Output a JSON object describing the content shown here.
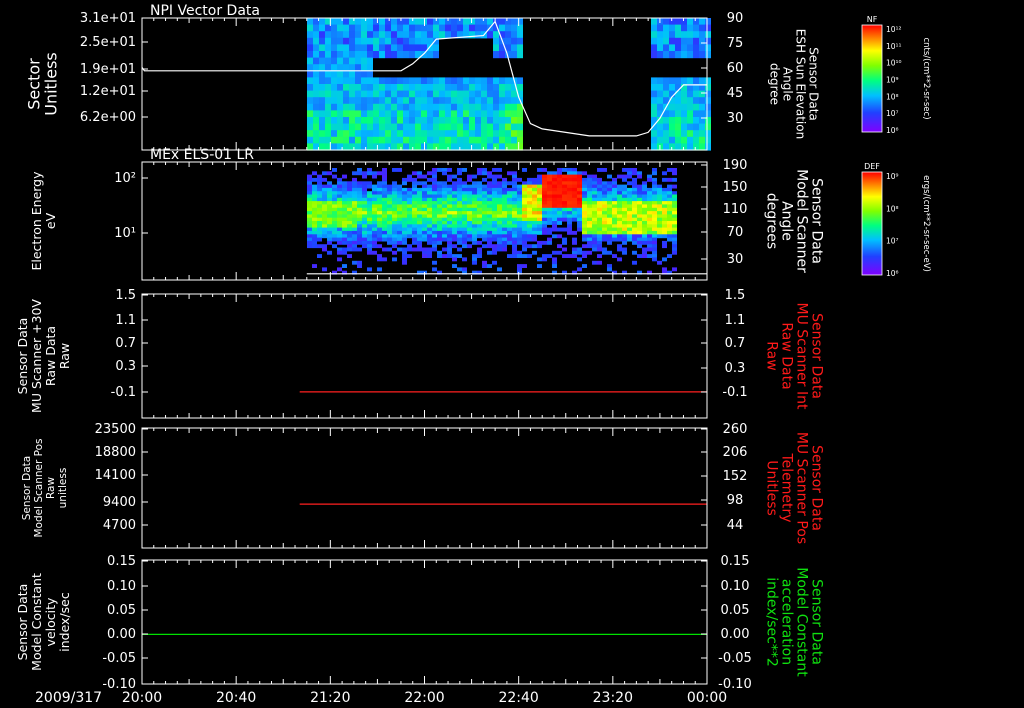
{
  "x_axis": {
    "date_label": "2009/317",
    "ticks": [
      "20:00",
      "20:40",
      "21:20",
      "22:00",
      "22:40",
      "23:20",
      "00:00"
    ],
    "range_minutes": [
      0,
      240
    ]
  },
  "colors": {
    "white_line": "#ffffff",
    "red_line": "#ff2020",
    "green_line": "#00e000",
    "red_axis_text": "#ff1a1a",
    "green_axis_text": "#10e010"
  },
  "panels": [
    {
      "id": "npi",
      "title": "NPI Vector Data",
      "left_label": [
        "Sector",
        "Unitless"
      ],
      "left_ticks": [
        "3.1e+01",
        "2.5e+01",
        "1.9e+01",
        "1.2e+01",
        "6.2e+00"
      ],
      "right_label": [
        "Sensor Data",
        "ESH Sun Elevation",
        "Angle",
        "degree"
      ],
      "right_label_color": "#ffffff",
      "right_ticks": [
        "90",
        "75",
        "60",
        "45",
        "30"
      ],
      "colorbar": {
        "tag": "NF",
        "units": "cnts/(cm**2-sr-sec)",
        "ticks": [
          "10¹²",
          "10¹¹",
          "10¹⁰",
          "10⁹",
          "10⁸",
          "10⁷",
          "10⁶"
        ]
      }
    },
    {
      "id": "els",
      "title": "MEx ELS-01 LR",
      "left_label": [
        "Electron Energy",
        "eV"
      ],
      "left_ticks": [
        "10²",
        "10¹"
      ],
      "right_label": [
        "Sensor Data",
        "Model Scanner",
        "Angle",
        "degrees"
      ],
      "right_label_color": "#ffffff",
      "right_ticks": [
        "190",
        "150",
        "110",
        "70",
        "30"
      ],
      "colorbar": {
        "tag": "DEF",
        "units": "ergs/(cm**2-sr-sec-eV)",
        "ticks": [
          "10⁹",
          "10⁸",
          "10⁷",
          "10⁶"
        ]
      }
    },
    {
      "id": "mu-raw",
      "title": "",
      "left_label": [
        "Sensor Data",
        "MU Scanner +30V",
        "Raw Data",
        "Raw"
      ],
      "left_ticks": [
        "1.5",
        "1.1",
        "0.7",
        "0.3",
        "-0.1"
      ],
      "right_label": [
        "Sensor Data",
        "MU Scanner Int",
        "Raw Data",
        "Raw"
      ],
      "right_label_color": "#ff1a1a",
      "right_ticks": [
        "1.5",
        "1.1",
        "0.7",
        "0.3",
        "-0.1"
      ]
    },
    {
      "id": "mu-pos",
      "title": "",
      "left_label": [
        "Sensor Data",
        "Model Scanner Pos",
        "Raw",
        "unitless"
      ],
      "left_ticks": [
        "23500",
        "18800",
        "14100",
        "9400",
        "4700"
      ],
      "right_label": [
        "Sensor Data",
        "MU Scanner Pos",
        "Telemetry",
        "Unitless"
      ],
      "right_label_color": "#ff1a1a",
      "right_ticks": [
        "260",
        "206",
        "152",
        "98",
        "44"
      ]
    },
    {
      "id": "velocity",
      "title": "",
      "left_label": [
        "Sensor Data",
        "Model Constant",
        "velocity",
        "index/sec"
      ],
      "left_ticks": [
        "0.15",
        "0.10",
        "0.05",
        "0.00",
        "-0.05",
        "-0.10"
      ],
      "right_label": [
        "Sensor Data",
        "Model Constant",
        "acceleration",
        "index/sec**2"
      ],
      "right_label_color": "#10e010",
      "right_ticks": [
        "0.15",
        "0.10",
        "0.05",
        "0.00",
        "-0.05",
        "-0.10"
      ]
    }
  ],
  "chart_data": [
    {
      "type": "heatmap",
      "title": "NPI Vector Data",
      "ylabel": "Sector Unitless",
      "data_coverage_minutes": [
        [
          70,
          162
        ],
        [
          216,
          240
        ]
      ],
      "line_series": {
        "name": "",
        "ylabel": "Sensor Data ESH Sun Elevation Angle degree",
        "ylim": [
          15,
          90
        ],
        "x_minutes": [
          0,
          1,
          3,
          20,
          60,
          110,
          115,
          120,
          125,
          145,
          150,
          155,
          160,
          165,
          170,
          180,
          190,
          200,
          210,
          215,
          220,
          225,
          230,
          240
        ],
        "y": [
          62,
          60,
          60,
          60,
          60,
          60,
          64,
          70,
          78,
          80,
          88,
          70,
          45,
          30,
          27,
          25,
          23,
          23,
          23,
          25,
          33,
          45,
          52,
          52
        ]
      }
    },
    {
      "type": "heatmap",
      "title": "MEx ELS-01 LR",
      "ylabel": "Electron Energy eV",
      "ylim_log": [
        1,
        180
      ],
      "data_coverage_minutes": [
        [
          70,
          226
        ]
      ],
      "line_series": {
        "name": "",
        "ylabel": "Sensor Data Model Scanner Angle degrees",
        "ylim": [
          0,
          190
        ],
        "x_minutes": [
          70,
          240
        ],
        "y": [
          10,
          10
        ]
      }
    },
    {
      "type": "line",
      "series": [
        {
          "name": "",
          "x_minutes": [
            67,
            240
          ],
          "y": [
            0.0,
            0.0
          ]
        }
      ],
      "ylim": [
        -0.4,
        1.5
      ]
    },
    {
      "type": "line",
      "series": [
        {
          "name": "",
          "x_minutes": [
            67,
            240
          ],
          "y": [
            8600,
            8600
          ]
        }
      ],
      "ylim": [
        0,
        23500
      ]
    },
    {
      "type": "line",
      "series": [
        {
          "name": "",
          "x_minutes": [
            0,
            240
          ],
          "y": [
            0.0,
            0.0
          ]
        }
      ],
      "ylim": [
        -0.1,
        0.15
      ]
    }
  ]
}
